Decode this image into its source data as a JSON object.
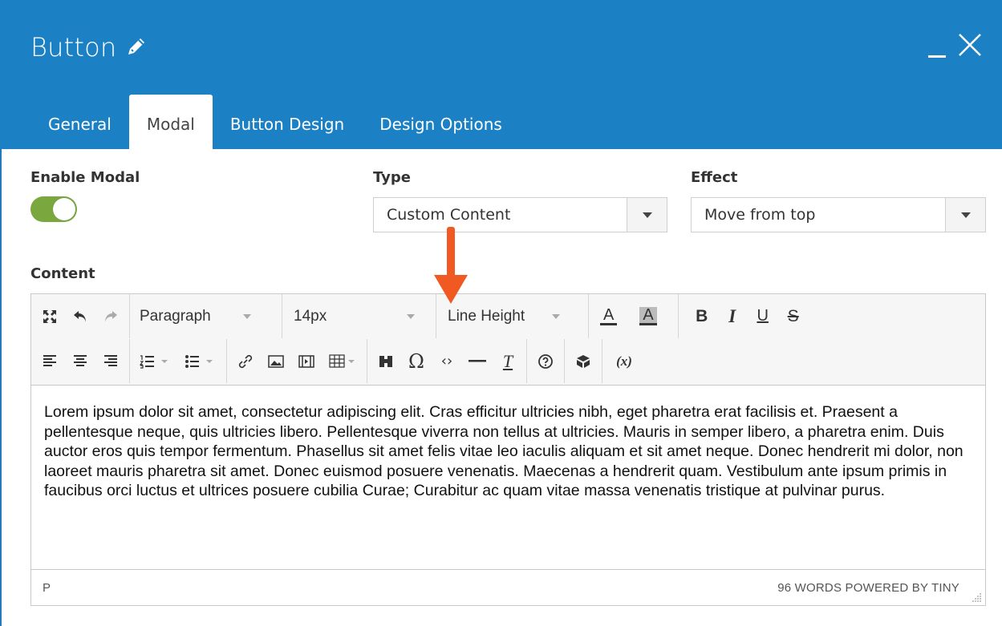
{
  "window": {
    "title": "Button",
    "header_color": "#1b80c4"
  },
  "tabs": [
    {
      "label": "General",
      "active": false
    },
    {
      "label": "Modal",
      "active": true
    },
    {
      "label": "Button Design",
      "active": false
    },
    {
      "label": "Design Options",
      "active": false
    }
  ],
  "form": {
    "enable_modal_label": "Enable Modal",
    "enable_modal_on": true,
    "toggle_color": "#7aa83f",
    "type_label": "Type",
    "type_value": "Custom Content",
    "effect_label": "Effect",
    "effect_value": "Move from top",
    "content_label": "Content"
  },
  "toolbar": {
    "format_value": "Paragraph",
    "font_size_value": "14px",
    "line_height_value": "Line Height",
    "text_color_label": "A",
    "bg_color_label": "A",
    "bold_label": "B",
    "italic_label": "I",
    "underline_label": "U",
    "strike_label": "S",
    "variable_label": "(x)"
  },
  "editor": {
    "content": "Lorem ipsum dolor sit amet, consectetur adipiscing elit. Cras efficitur ultricies nibh, eget pharetra erat facilisis et. Praesent a pellentesque neque, quis ultricies libero. Pellentesque viverra non tellus at ultricies. Mauris in semper libero, a pharetra enim. Duis auctor eros quis tempor fermentum. Phasellus sit amet felis vitae leo iaculis aliquam et sit amet neque. Donec hendrerit mi dolor, non laoreet mauris pharetra sit amet. Donec euismod posuere venenatis. Maecenas a hendrerit quam. Vestibulum ante ipsum primis in faucibus orci luctus et ultrices posuere cubilia Curae; Curabitur ac quam vitae massa venenatis tristique at pulvinar purus.",
    "status_path": "P",
    "status_right": "96 WORDS POWERED BY TINY"
  },
  "annotation": {
    "arrow_color": "#f05a22"
  }
}
